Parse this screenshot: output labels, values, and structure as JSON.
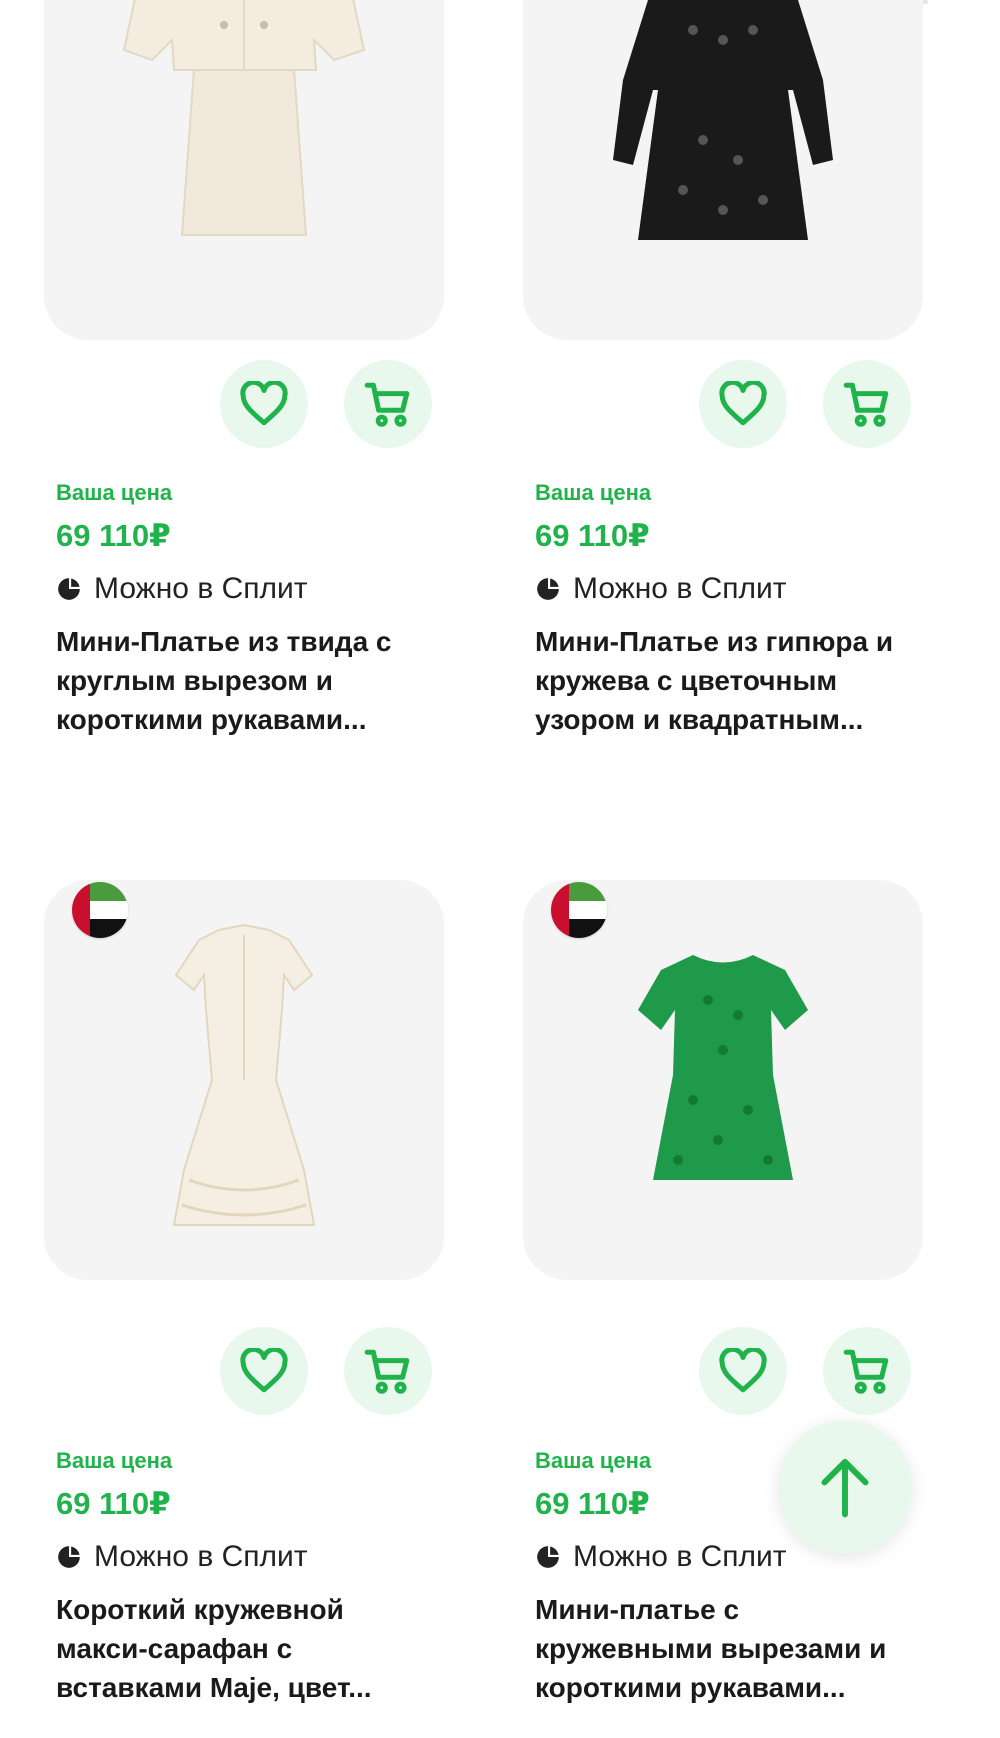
{
  "products": [
    {
      "price_label": "Ваша цена",
      "price": "69 110₽",
      "split": "Можно в Сплит",
      "title": "Мини-Платье из твида с круглым вырезом и короткими рукавами...",
      "image": "cream tweed dress",
      "has_flag": false
    },
    {
      "price_label": "Ваша цена",
      "price": "69 110₽",
      "split": "Можно в Сплит",
      "title": "Мини-Платье из гипюра и кружева с цветочным узором и квадратным...",
      "image": "black lace dress",
      "has_flag": false
    },
    {
      "price_label": "Ваша цена",
      "price": "69 110₽",
      "split": "Можно в Сплит",
      "title": "Короткий кружевной макси-сарафан с вставками Maje, цвет...",
      "image": "white maxi dress",
      "has_flag": true,
      "flag": "uae-flag"
    },
    {
      "price_label": "Ваша цена",
      "price": "69 110₽",
      "split": "Можно в Сплит",
      "title": "Мини-платье с кружевными вырезами и короткими рукавами...",
      "image": "green lace dress",
      "has_flag": true,
      "flag": "uae-flag"
    }
  ],
  "colors": {
    "accent": "#21b34b",
    "button_bg": "#e9f8ec",
    "card_bg": "#f4f4f4"
  },
  "icons": [
    "heart-icon",
    "cart-icon",
    "split-icon",
    "arrow-up-icon"
  ]
}
